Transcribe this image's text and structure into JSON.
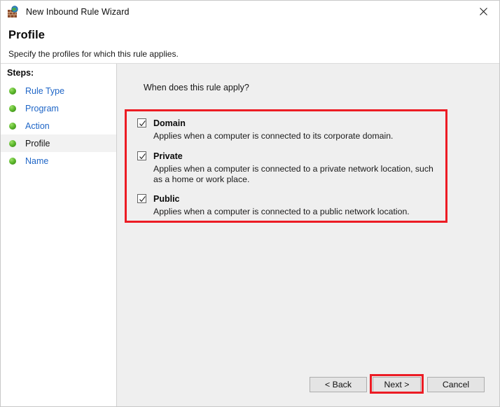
{
  "window": {
    "title": "New Inbound Rule Wizard",
    "icon": "firewall-globe-icon",
    "close_label": "✕"
  },
  "header": {
    "title": "Profile",
    "subtitle": "Specify the profiles for which this rule applies."
  },
  "sidebar": {
    "heading": "Steps:",
    "items": [
      {
        "label": "Rule Type",
        "current": false
      },
      {
        "label": "Program",
        "current": false
      },
      {
        "label": "Action",
        "current": false
      },
      {
        "label": "Profile",
        "current": true
      },
      {
        "label": "Name",
        "current": false
      }
    ]
  },
  "main": {
    "question": "When does this rule apply?",
    "options": [
      {
        "name": "Domain",
        "checked": true,
        "description": "Applies when a computer is connected to its corporate domain."
      },
      {
        "name": "Private",
        "checked": true,
        "description": "Applies when a computer is connected to a private network location, such as a home or work place."
      },
      {
        "name": "Public",
        "checked": true,
        "description": "Applies when a computer is connected to a public network location."
      }
    ]
  },
  "footer": {
    "back_label": "< Back",
    "next_label": "Next >",
    "cancel_label": "Cancel"
  },
  "annotations": {
    "highlight_color": "#ec1c24",
    "targets": [
      "profile-options-group",
      "next-button"
    ]
  }
}
